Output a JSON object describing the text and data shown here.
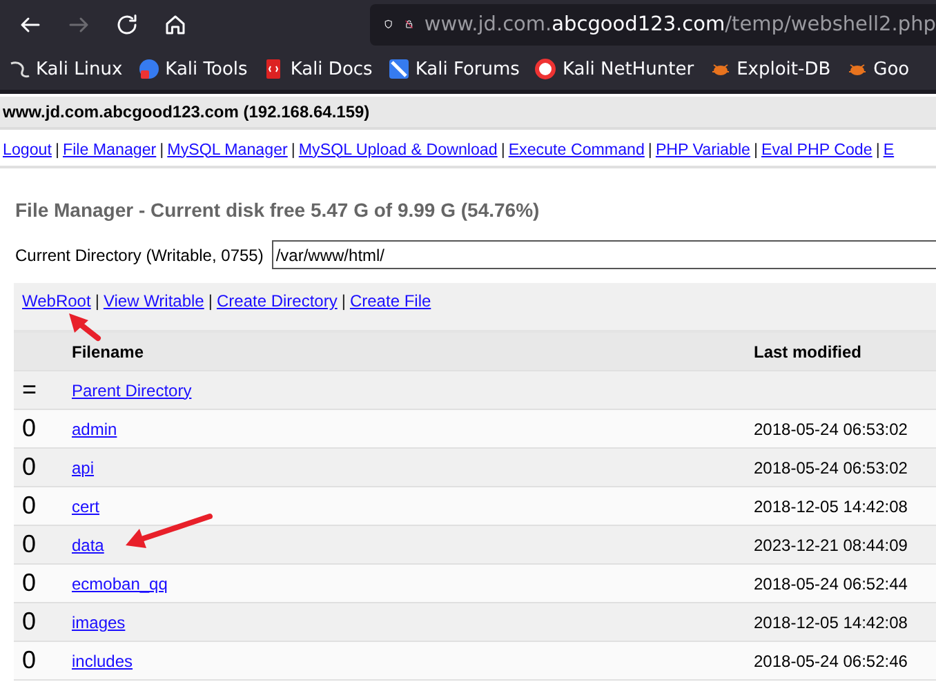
{
  "browser": {
    "url_host_prefix": "www.jd.com.",
    "url_host": "abcgood123.com",
    "url_path": "/temp/webshell2.php"
  },
  "bookmarks": [
    "Kali Linux",
    "Kali Tools",
    "Kali Docs",
    "Kali Forums",
    "Kali NetHunter",
    "Exploit-DB",
    "Goo"
  ],
  "host_bar": {
    "title": "www.jd.com.abcgood123.com (192.168.64.159)"
  },
  "nav_links": [
    "Logout",
    "File Manager",
    "MySQL Manager",
    "MySQL Upload & Download",
    "Execute Command",
    "PHP Variable",
    "Eval PHP Code",
    "E"
  ],
  "separator": "|",
  "heading": "File Manager - Current disk free 5.47 G of 9.99 G (54.76%)",
  "directory": {
    "label": "Current Directory (Writable, 0755)",
    "value": "/var/www/html/"
  },
  "actions": [
    "WebRoot",
    "View Writable",
    "Create Directory",
    "Create File"
  ],
  "table": {
    "columns": [
      "Filename",
      "Last modified"
    ],
    "rows": [
      {
        "marker": "=",
        "name": "Parent Directory"
      },
      {
        "marker": "0",
        "name": "admin",
        "modified": "2018-05-24 06:53:02"
      },
      {
        "marker": "0",
        "name": "api",
        "modified": "2018-05-24 06:53:02"
      },
      {
        "marker": "0",
        "name": "cert",
        "modified": "2018-12-05 14:42:08"
      },
      {
        "marker": "0",
        "name": "data",
        "modified": "2023-12-21 08:44:09"
      },
      {
        "marker": "0",
        "name": "ecmoban_qq",
        "modified": "2018-05-24 06:52:44"
      },
      {
        "marker": "0",
        "name": "images",
        "modified": "2018-12-05 14:42:08"
      },
      {
        "marker": "0",
        "name": "includes",
        "modified": "2018-05-24 06:52:46"
      }
    ]
  }
}
